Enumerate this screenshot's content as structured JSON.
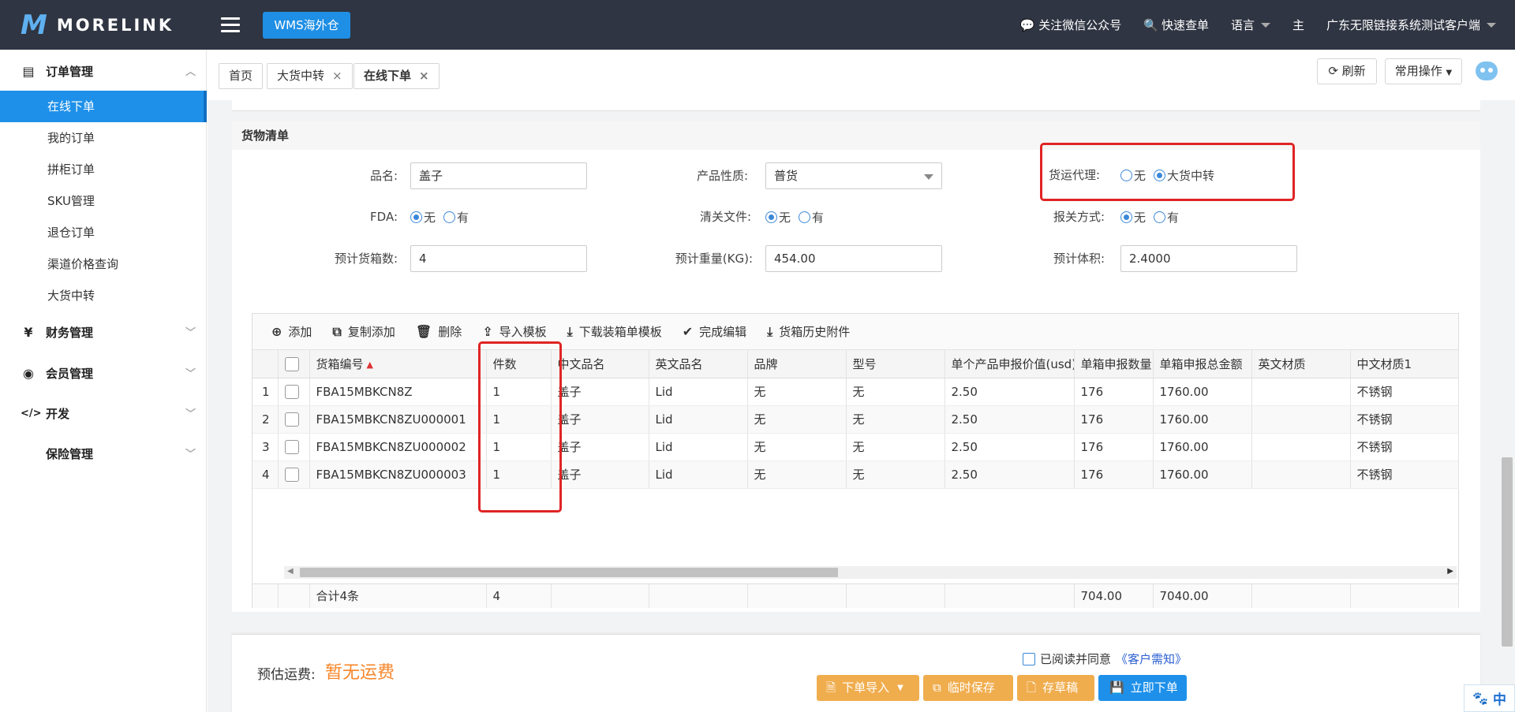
{
  "app": {
    "logo_mark": "M",
    "logo_text": "MORELINK",
    "wms_button": "WMS海外仓"
  },
  "topnav": {
    "wechat": "关注微信公众号",
    "quick_query": "快速查单",
    "language": "语言",
    "theme": "主",
    "account": "广东无限链接系统测试客户端"
  },
  "sidebar": {
    "groups": [
      {
        "icon": "▤",
        "label": "订单管理",
        "chevron": "︿"
      },
      {
        "icon": "¥",
        "label": "财务管理",
        "chevron": "﹀"
      },
      {
        "icon": "◉",
        "label": "会员管理",
        "chevron": "﹀"
      },
      {
        "icon": "</>",
        "label": "开发",
        "chevron": "﹀"
      },
      {
        "icon": "",
        "label": "保险管理",
        "chevron": "﹀"
      }
    ],
    "items": [
      "在线下单",
      "我的订单",
      "拼柜订单",
      "SKU管理",
      "退仓订单",
      "渠道价格查询",
      "大货中转"
    ]
  },
  "tabs": {
    "home": "首页",
    "bulk": "大货中转",
    "online": "在线下单",
    "close": "×",
    "refresh": "刷新",
    "common_ops": "常用操作"
  },
  "goods": {
    "title": "货物清单",
    "product_name_label": "品名:",
    "product_name": "盖子",
    "product_nature_label": "产品性质:",
    "product_nature": "普货",
    "forwarder_label": "货运代理:",
    "forwarder_opts": [
      "无",
      "大货中转"
    ],
    "fda_label": "FDA:",
    "clearance_label": "清关文件:",
    "customs_label": "报关方式:",
    "opts_yes_no": [
      "无",
      "有"
    ],
    "boxes_label": "预计货箱数:",
    "boxes": "4",
    "weight_label": "预计重量(KG):",
    "weight": "454.00",
    "volume_label": "预计体积:",
    "volume": "2.4000"
  },
  "toolbar": {
    "add": "添加",
    "copy_add": "复制添加",
    "delete": "删除",
    "import": "导入模板",
    "download": "下载装箱单模板",
    "finish": "完成编辑",
    "history": "货箱历史附件"
  },
  "table": {
    "headers": [
      "货箱编号",
      "件数",
      "中文品名",
      "英文品名",
      "品牌",
      "型号",
      "单个产品申报价值(usd)",
      "单箱申报数量",
      "单箱申报总金额",
      "英文材质",
      "中文材质1"
    ],
    "rows": [
      {
        "n": "1",
        "box": "FBA15MBKCN8Z",
        "qty": "1",
        "cn": "盖子",
        "en": "Lid",
        "brand": "无",
        "model": "无",
        "price": "2.50",
        "count": "176",
        "total": "1760.00",
        "enmat": "",
        "cnmat": "不锈钢"
      },
      {
        "n": "2",
        "box": "FBA15MBKCN8ZU000001",
        "qty": "1",
        "cn": "盖子",
        "en": "Lid",
        "brand": "无",
        "model": "无",
        "price": "2.50",
        "count": "176",
        "total": "1760.00",
        "enmat": "",
        "cnmat": "不锈钢"
      },
      {
        "n": "3",
        "box": "FBA15MBKCN8ZU000002",
        "qty": "1",
        "cn": "盖子",
        "en": "Lid",
        "brand": "无",
        "model": "无",
        "price": "2.50",
        "count": "176",
        "total": "1760.00",
        "enmat": "",
        "cnmat": "不锈钢"
      },
      {
        "n": "4",
        "box": "FBA15MBKCN8ZU000003",
        "qty": "1",
        "cn": "盖子",
        "en": "Lid",
        "brand": "无",
        "model": "无",
        "price": "2.50",
        "count": "176",
        "total": "1760.00",
        "enmat": "",
        "cnmat": "不锈钢"
      }
    ],
    "summary": {
      "label": "合计4条",
      "qty": "4",
      "count": "704.00",
      "total": "7040.00"
    }
  },
  "footer": {
    "fee_label": "预估运费:",
    "fee_value": "暂无运费",
    "agree_text": "已阅读并同意",
    "agree_link": "《客户需知》",
    "btn_import": "下单导入",
    "btn_temp": "临时保存",
    "btn_draft": "存草稿",
    "btn_submit": "立即下单"
  },
  "baidu": {
    "paw": "🐾",
    "lang": "中"
  },
  "colors": {
    "topbar": "#2f3542",
    "accent": "#1e90ea",
    "orange": "#f0ad4e",
    "fee": "#f7862a",
    "highlight": "#e02424"
  }
}
